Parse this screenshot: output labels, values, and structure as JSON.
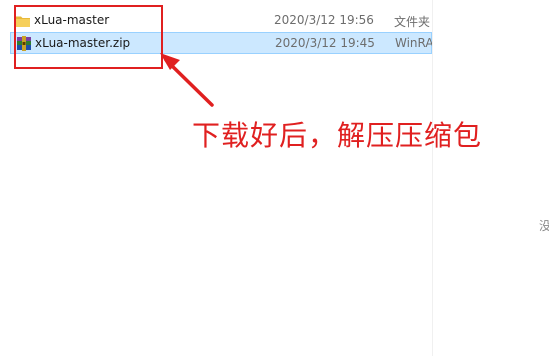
{
  "files": [
    {
      "name": "xLua-master",
      "modified": "2020/3/12 19:56",
      "type": "文件夹",
      "icon": "folder-icon",
      "selected": false
    },
    {
      "name": "xLua-master.zip",
      "modified": "2020/3/12 19:45",
      "type": "WinRAR",
      "icon": "winrar-archive-icon",
      "selected": true
    }
  ],
  "annotation": {
    "text": "下载好后，解压压缩包",
    "color": "#e02020"
  },
  "edge_text": "没",
  "colors": {
    "selection_fill": "#cce8ff",
    "selection_border": "#99d1ff",
    "folder": "#f4c542"
  }
}
